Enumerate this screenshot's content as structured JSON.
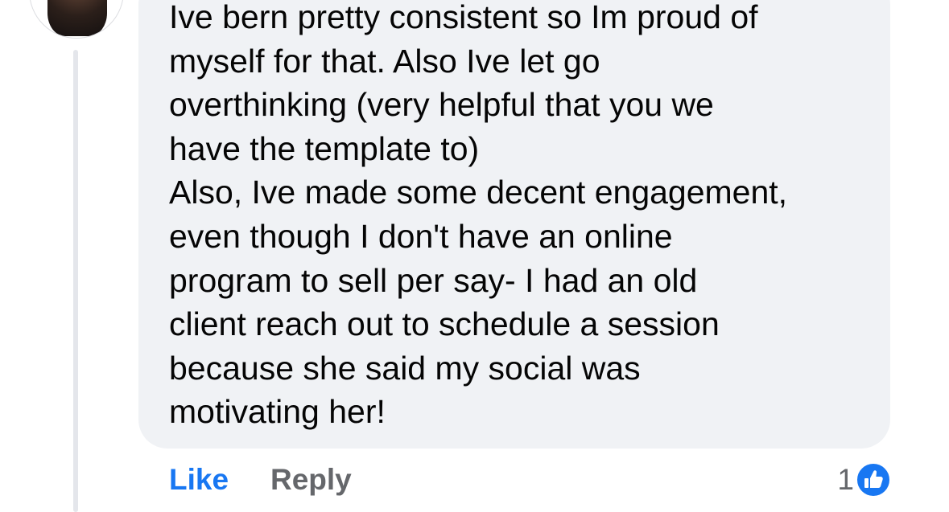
{
  "comment": {
    "lines": [
      "Ive bern pretty consistent so Im proud of",
      "myself for that. Also Ive let go",
      "overthinking  (very helpful that you we",
      "have the template to)",
      "Also, Ive made some decent engagement,",
      "even though I don't have an online",
      "program to sell per say- I had an old",
      "client reach out to schedule a session",
      "because she said my social was",
      "motivating her!"
    ]
  },
  "actions": {
    "like_label": "Like",
    "reply_label": "Reply"
  },
  "reactions": {
    "count": "1",
    "icon": "thumbs-up-icon"
  },
  "colors": {
    "accent": "#1877f2",
    "bubble": "#f0f2f5",
    "muted_text": "#65676b",
    "text": "#050505"
  }
}
